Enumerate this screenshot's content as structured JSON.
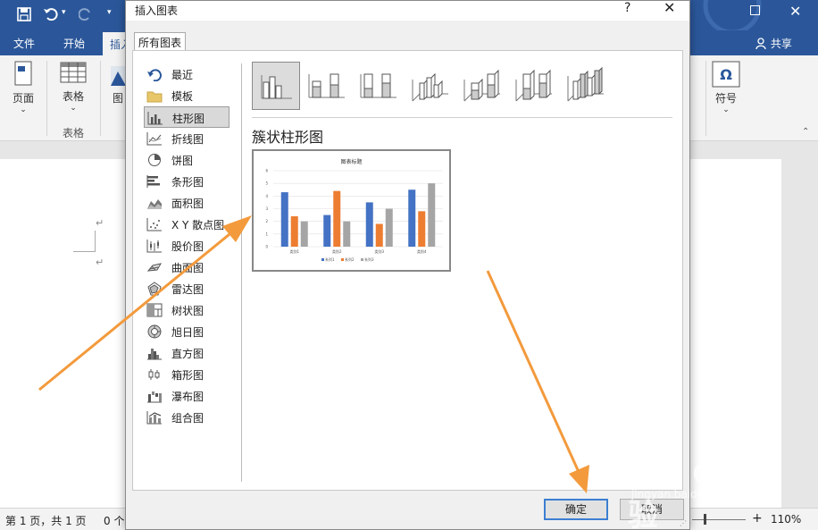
{
  "word": {
    "tabs": [
      {
        "label": "文件"
      },
      {
        "label": "开始"
      },
      {
        "label": "插入"
      }
    ],
    "share_label": "共享",
    "ribbon": {
      "page_label": "页面",
      "table_label": "表格",
      "table_group_label": "表格",
      "image_label": "图",
      "symbol_label": "符号"
    },
    "status": {
      "page_info": "第 1 页，共 1 页",
      "word_count": "0 个",
      "zoom": "110%"
    }
  },
  "dialog": {
    "title": "插入图表",
    "help": "?",
    "close": "✕",
    "tab": "所有图表",
    "categories": [
      {
        "label": "最近",
        "icon": "recent-icon"
      },
      {
        "label": "模板",
        "icon": "folder-icon"
      },
      {
        "label": "柱形图",
        "icon": "column-chart-icon",
        "selected": true
      },
      {
        "label": "折线图",
        "icon": "line-chart-icon"
      },
      {
        "label": "饼图",
        "icon": "pie-chart-icon"
      },
      {
        "label": "条形图",
        "icon": "bar-chart-icon"
      },
      {
        "label": "面积图",
        "icon": "area-chart-icon"
      },
      {
        "label": "X Y 散点图",
        "icon": "scatter-chart-icon"
      },
      {
        "label": "股价图",
        "icon": "stock-chart-icon"
      },
      {
        "label": "曲面图",
        "icon": "surface-chart-icon"
      },
      {
        "label": "雷达图",
        "icon": "radar-chart-icon"
      },
      {
        "label": "树状图",
        "icon": "treemap-chart-icon"
      },
      {
        "label": "旭日图",
        "icon": "sunburst-chart-icon"
      },
      {
        "label": "直方图",
        "icon": "histogram-chart-icon"
      },
      {
        "label": "箱形图",
        "icon": "box-whisker-chart-icon"
      },
      {
        "label": "瀑布图",
        "icon": "waterfall-chart-icon"
      },
      {
        "label": "组合图",
        "icon": "combo-chart-icon"
      }
    ],
    "subtypes": [
      {
        "icon": "clustered-column-icon",
        "selected": true
      },
      {
        "icon": "stacked-column-icon"
      },
      {
        "icon": "100-stacked-column-icon"
      },
      {
        "icon": "3d-clustered-column-icon"
      },
      {
        "icon": "3d-stacked-column-icon"
      },
      {
        "icon": "3d-100-stacked-column-icon"
      },
      {
        "icon": "3d-column-icon"
      }
    ],
    "chart_type_title": "簇状柱形图",
    "preview_title": "图表标题",
    "ok_label": "确定",
    "cancel_label": "取消"
  },
  "chart_data": {
    "type": "bar",
    "title": "图表标题",
    "categories": [
      "类别1",
      "类别2",
      "类别3",
      "类别4"
    ],
    "series": [
      {
        "name": "系列1",
        "values": [
          4.3,
          2.5,
          3.5,
          4.5
        ],
        "color": "#4472c4"
      },
      {
        "name": "系列2",
        "values": [
          2.4,
          4.4,
          1.8,
          2.8
        ],
        "color": "#ed7d31"
      },
      {
        "name": "系列3",
        "values": [
          2,
          2,
          3,
          5
        ],
        "color": "#a5a5a5"
      }
    ],
    "ylim": [
      0,
      6
    ],
    "grid": true,
    "legend_position": "bottom"
  },
  "colors": {
    "word_blue": "#2b579a",
    "arrow_orange": "#f39a3c",
    "ok_border": "#3b7fd1"
  },
  "watermark": {
    "logo": "Bai du 经验",
    "sub": "jingyan.baidu.com"
  }
}
